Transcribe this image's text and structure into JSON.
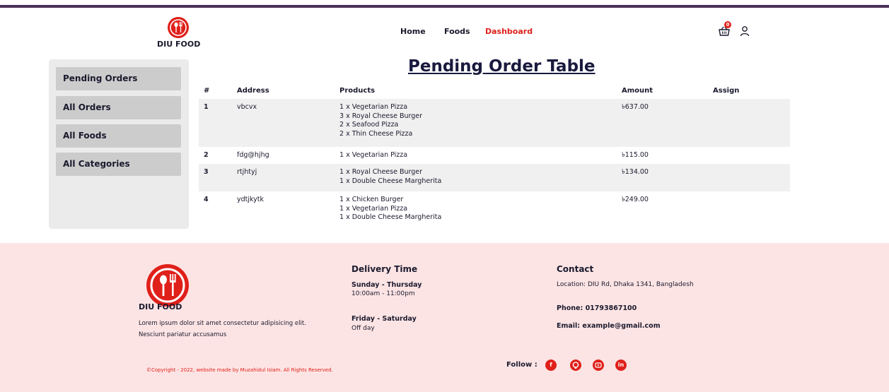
{
  "brand": {
    "name": "DIU FOOD"
  },
  "nav": {
    "home": "Home",
    "foods": "Foods",
    "dashboard": "Dashboard"
  },
  "cart": {
    "count": "0"
  },
  "colors": {
    "accent": "#e0201a",
    "topbar": "#4a3157",
    "footer_bg": "#fde4e4",
    "sidebar_bg": "#ebebeb",
    "sidebar_item_bg": "#cccccc"
  },
  "icons": {
    "cart": "shopping-basket-icon",
    "user": "user-icon",
    "logo": "fork-spoon-icon"
  },
  "sidebar": {
    "items": [
      {
        "label": "Pending Orders"
      },
      {
        "label": "All Orders"
      },
      {
        "label": "All Foods"
      },
      {
        "label": "All Categories"
      }
    ]
  },
  "table": {
    "title": "Pending Order Table",
    "headers": {
      "num": "#",
      "address": "Address",
      "products": "Products",
      "amount": "Amount",
      "assign": "Assign"
    },
    "rows": [
      {
        "num": "1",
        "address": "vbcvx",
        "products": [
          "1 x Vegetarian Pizza",
          "3 x Royal Cheese Burger",
          "2 x Seafood Pizza",
          "2 x Thin Cheese Pizza"
        ],
        "amount": "৳637.00"
      },
      {
        "num": "2",
        "address": "fdg@hjhg",
        "products": [
          "1 x Vegetarian Pizza"
        ],
        "amount": "৳115.00"
      },
      {
        "num": "3",
        "address": "rtjhtyj",
        "products": [
          "1 x Royal Cheese Burger",
          "1 x Double Cheese Margherita"
        ],
        "amount": "৳134.00"
      },
      {
        "num": "4",
        "address": "ydtjkytk",
        "products": [
          "1 x Chicken Burger",
          "1 x Vegetarian Pizza",
          "1 x Double Cheese Margherita"
        ],
        "amount": "৳249.00"
      }
    ]
  },
  "footer": {
    "brand": "DIU FOOD",
    "description": "Lorem ipsum dolor sit amet consectetur adipisicing elit. Nesciunt pariatur accusamus",
    "delivery": {
      "title": "Delivery Time",
      "weekday_days": "Sunday - Thursday",
      "weekday_hours": "10:00am - 11:00pm",
      "weekend_days": "Friday - Saturday",
      "weekend_hours": "Off day"
    },
    "contact": {
      "title": "Contact",
      "location": "Location: DIU Rd, Dhaka 1341, Bangladesh",
      "phone": "Phone: 01793867100",
      "email": "Email: example@gmail.com"
    },
    "copyright": "©Copyright - 2022, website made by Muzahidul Islam. All Rights Reserved.",
    "follow": "Follow :",
    "social": [
      "facebook-icon",
      "github-icon",
      "youtube-icon",
      "linkedin-icon"
    ]
  }
}
